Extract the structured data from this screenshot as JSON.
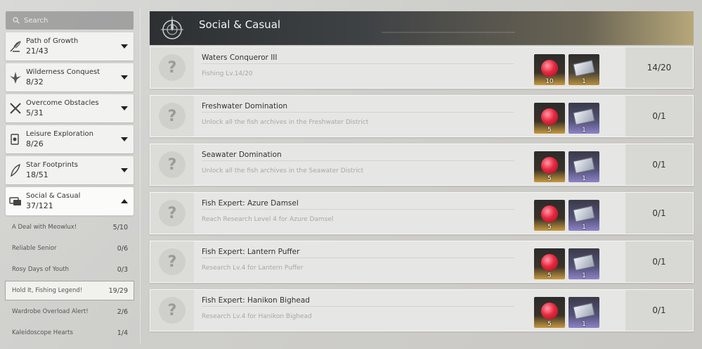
{
  "search": {
    "placeholder": "Search"
  },
  "categories": [
    {
      "name": "Path of Growth",
      "count": "21/43",
      "icon": "quill-icon"
    },
    {
      "name": "Wilderness Conquest",
      "count": "8/32",
      "icon": "claw-icon"
    },
    {
      "name": "Overcome Obstacles",
      "count": "5/31",
      "icon": "crossed-swords-icon"
    },
    {
      "name": "Leisure Exploration",
      "count": "8/26",
      "icon": "camera-icon"
    },
    {
      "name": "Star Footprints",
      "count": "18/51",
      "icon": "feather-icon"
    },
    {
      "name": "Social & Casual",
      "count": "37/121",
      "icon": "chat-icon"
    }
  ],
  "subitems": [
    {
      "name": "A Deal with Meowlux!",
      "count": "5/10"
    },
    {
      "name": "Reliable Senior",
      "count": "0/6"
    },
    {
      "name": "Rosy Days of Youth",
      "count": "0/3"
    },
    {
      "name": "Hold It, Fishing Legend!",
      "count": "19/29"
    },
    {
      "name": "Wardrobe Overload Alert!",
      "count": "2/6"
    },
    {
      "name": "Kaleidoscope Hearts",
      "count": "1/4"
    }
  ],
  "header": {
    "title": "Social & Casual"
  },
  "achievements": [
    {
      "title": "Waters Conqueror III",
      "desc": "Fishing Lv.14/20",
      "gem_qty": "10",
      "ticket_qty": "1",
      "ticket_tier": "gold",
      "progress": "14/20"
    },
    {
      "title": "Freshwater Domination",
      "desc": "Unlock all the fish archives in the Freshwater District",
      "gem_qty": "5",
      "ticket_qty": "1",
      "ticket_tier": "purple",
      "progress": "0/1"
    },
    {
      "title": "Seawater Domination",
      "desc": "Unlock all the fish archives in the Seawater District",
      "gem_qty": "5",
      "ticket_qty": "1",
      "ticket_tier": "purple",
      "progress": "0/1"
    },
    {
      "title": "Fish Expert: Azure Damsel",
      "desc": "Reach Research Level 4 for Azure Damsel",
      "gem_qty": "5",
      "ticket_qty": "1",
      "ticket_tier": "purple",
      "progress": "0/1"
    },
    {
      "title": "Fish Expert: Lantern Puffer",
      "desc": "Research Lv.4 for Lantern Puffer",
      "gem_qty": "5",
      "ticket_qty": "1",
      "ticket_tier": "purple",
      "progress": "0/1"
    },
    {
      "title": "Fish Expert: Hanikon Bighead",
      "desc": "Research Lv.4 for Hanikon Bighead",
      "gem_qty": "5",
      "ticket_qty": "1",
      "ticket_tier": "purple",
      "progress": "0/1"
    }
  ]
}
